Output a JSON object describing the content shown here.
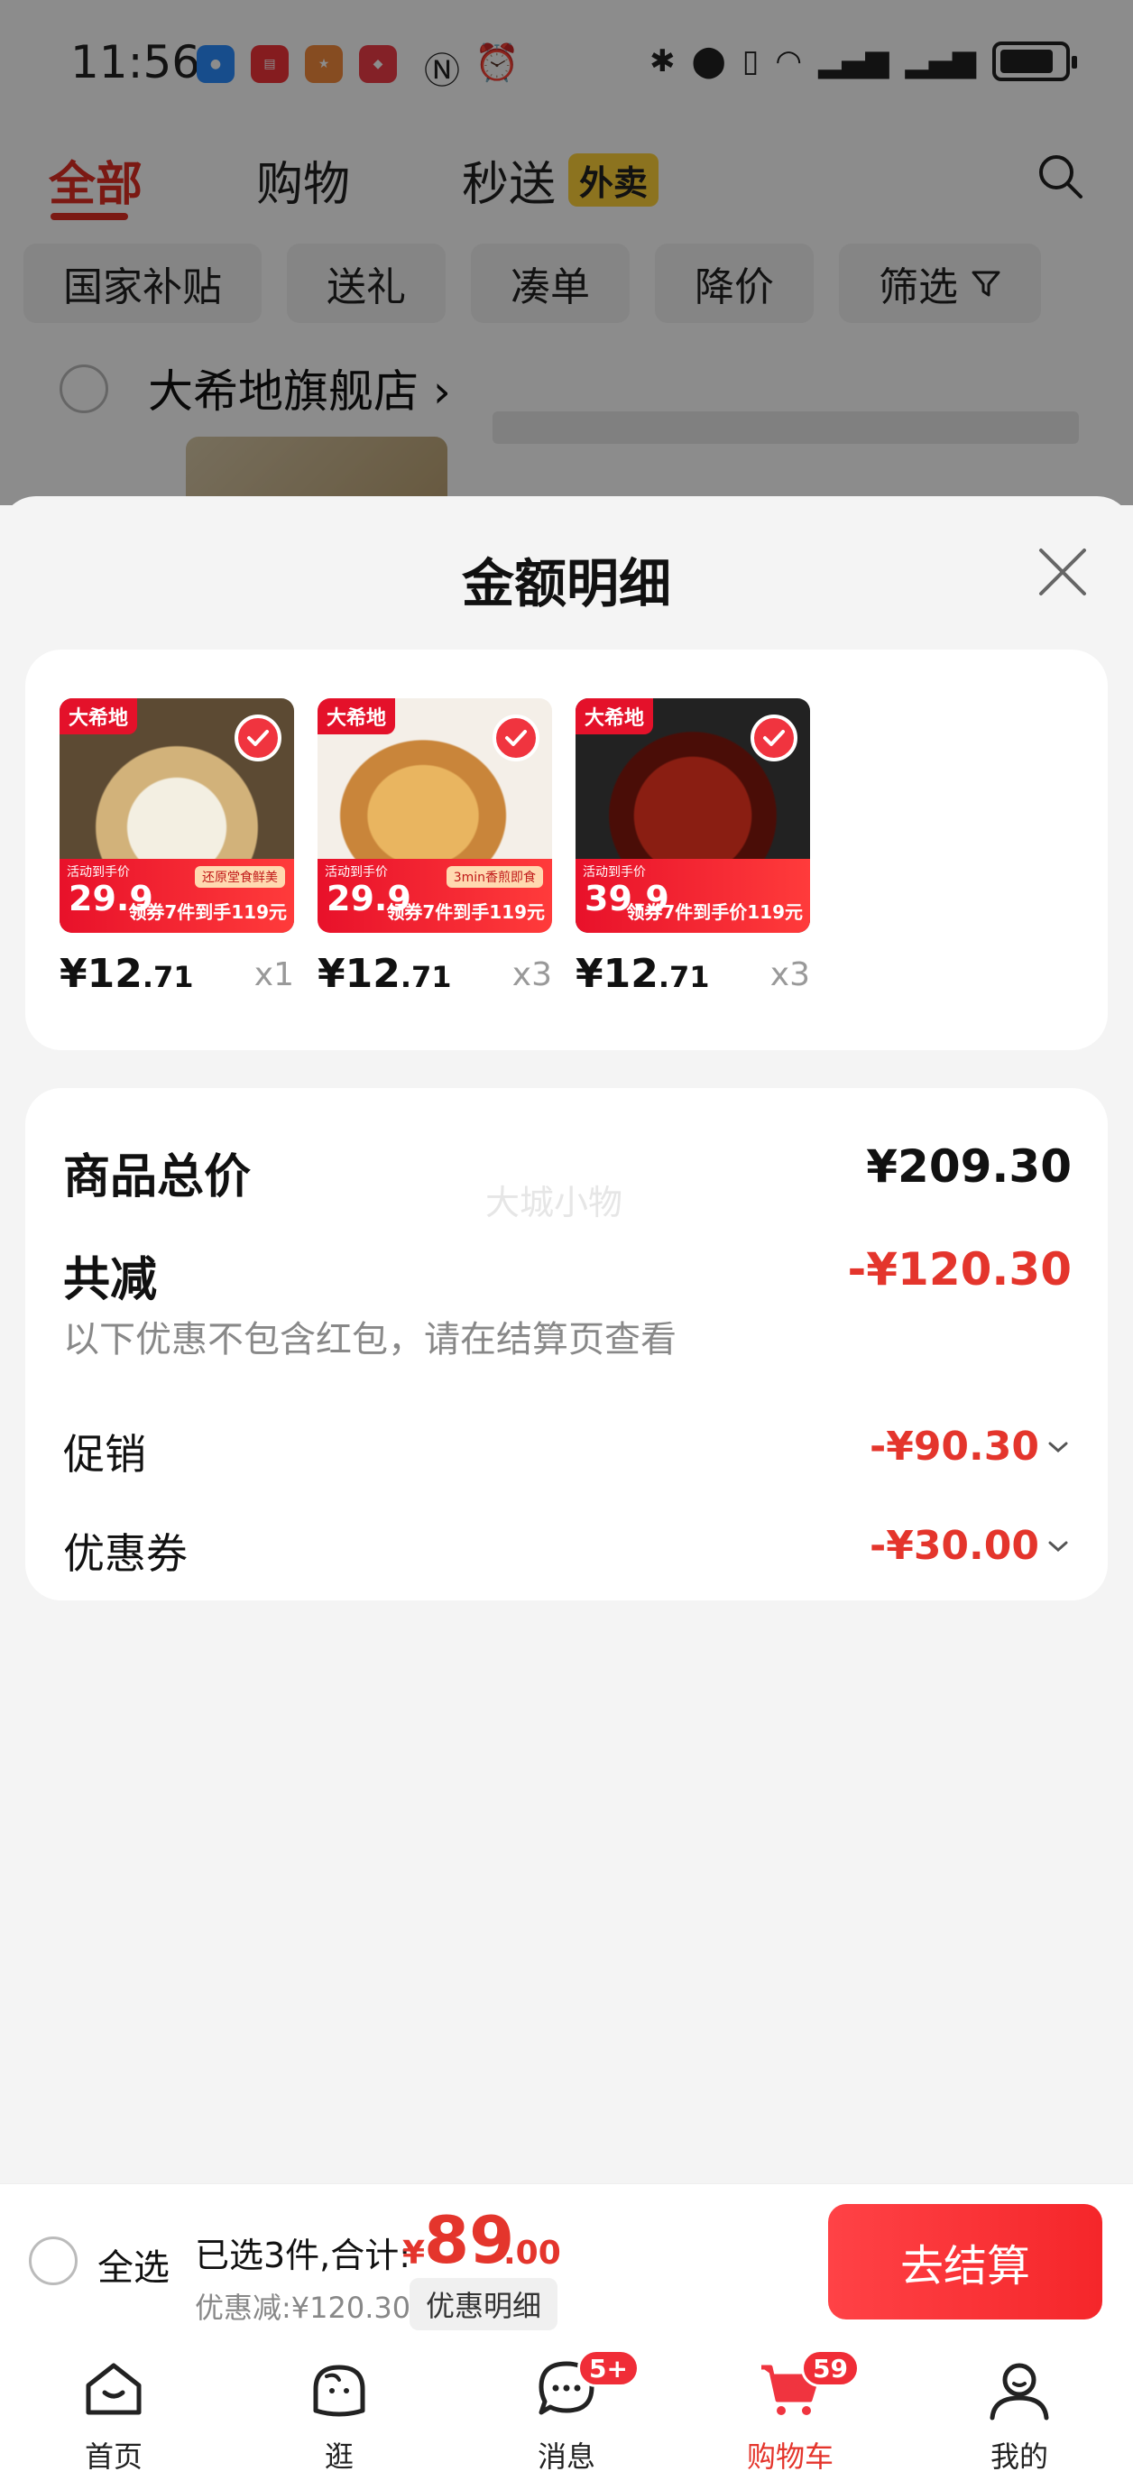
{
  "status_bar": {
    "time": "11:56",
    "network": "6"
  },
  "top_nav": {
    "tabs": [
      {
        "label": "全部",
        "active": true
      },
      {
        "label": "购物",
        "active": false
      },
      {
        "label": "秒送",
        "active": false
      }
    ],
    "waimai_badge": "外卖"
  },
  "filter_chips": [
    "国家补贴",
    "送礼",
    "凑单",
    "降价",
    "筛选"
  ],
  "store": {
    "name": "大希地旗舰店"
  },
  "sheet": {
    "title": "金额明细",
    "products": [
      {
        "brand": "大希地",
        "promo_small": "活动到手价",
        "promo_price": "29.9",
        "promo_tag": "还原堂食鲜美",
        "promo_line": "领券7件到手119元",
        "price_int": "¥12",
        "price_dec": ".71",
        "qty": "x1"
      },
      {
        "brand": "大希地",
        "promo_small": "活动到手价",
        "promo_price": "29.9",
        "promo_tag": "3min香煎即食",
        "promo_line": "领券7件到手119元",
        "price_int": "¥12",
        "price_dec": ".71",
        "qty": "x3"
      },
      {
        "brand": "大希地",
        "promo_small": "活动到手价",
        "promo_price": "39.9",
        "promo_tag": "",
        "promo_line": "领券7件到手价119元",
        "price_int": "¥12",
        "price_dec": ".71",
        "qty": "x3"
      }
    ],
    "summary": {
      "total_label": "商品总价",
      "total_value": "¥209.30",
      "watermark": "大城小物",
      "reduce_label": "共减",
      "reduce_value": "-¥120.30",
      "hint": "以下优惠不包含红包，请在结算页查看",
      "promo_label": "促销",
      "promo_value": "-¥90.30",
      "coupon_label": "优惠券",
      "coupon_value": "-¥30.00"
    }
  },
  "action_bar": {
    "select_all": "全选",
    "selected_text": "已选3件,合计:",
    "yen": "¥",
    "total_int": "89",
    "total_dec": ".00",
    "discount_text": "优惠减:¥120.30",
    "detail_button": "优惠明细",
    "checkout_button": "去结算"
  },
  "tab_bar": {
    "items": [
      {
        "label": "首页"
      },
      {
        "label": "逛"
      },
      {
        "label": "消息",
        "badge": "5+"
      },
      {
        "label": "购物车",
        "badge": "59",
        "active": true
      },
      {
        "label": "我的"
      }
    ]
  },
  "colors": {
    "accent": "#e4352c",
    "checkout": "#f5262a",
    "waimai": "#ffd23a"
  }
}
